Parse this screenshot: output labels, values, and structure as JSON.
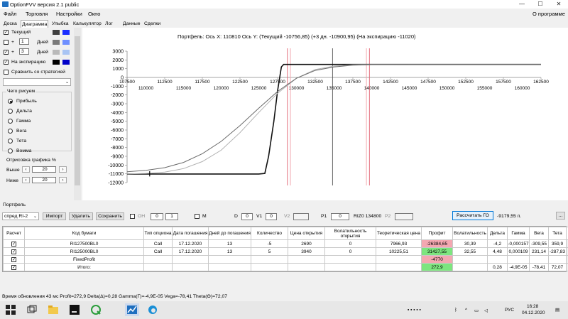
{
  "window": {
    "title": "OptionFVV версия 2.1 public",
    "buttons": [
      "—",
      "☐",
      "✕"
    ]
  },
  "menu": {
    "items": [
      "Файл",
      "Торговля",
      "Настройки",
      "Окно"
    ],
    "about": "О программе"
  },
  "tabs": [
    "Доска",
    "Диаграмма",
    "Улыбка",
    "Калькулятор",
    "Лог",
    "Данные",
    "Сделки"
  ],
  "left": {
    "current": {
      "label": "Текущий",
      "checked": true,
      "colors": [
        "#404040",
        "#1a2dff"
      ]
    },
    "plus1": {
      "sign": "+",
      "value": "1",
      "unit": "Дней",
      "checked": false,
      "colors": [
        "#7a7a7a",
        "#6f8fff"
      ]
    },
    "plus3": {
      "sign": "+",
      "value": "3",
      "unit": "Дней",
      "checked": true,
      "colors": [
        "#b9b9b9",
        "#a9c4f3"
      ]
    },
    "expiry": {
      "label": "На экспирацию",
      "checked": true,
      "colors": [
        "#000000",
        "#0000c8"
      ]
    },
    "compare": {
      "label": "Сравнить со стратегией",
      "checked": false
    },
    "what_label": "Чего рисуем",
    "radios": [
      "Прибыль",
      "Дельта",
      "Гамма",
      "Вега",
      "Тета",
      "Вомма"
    ],
    "selected_radio": 0,
    "draw_label": "Отрисовка графика %",
    "above_label": "Выше",
    "above_value": "20",
    "below_label": "Ниже",
    "below_value": "20"
  },
  "chart_title": "Портфель: Ось X: 110810 Ось Y: (Текущий -10756,85) (+3 дн. -10900,95) (На экспирацию -11020)",
  "chart_data": {
    "type": "line",
    "y_ticks": [
      3000,
      2000,
      1000,
      0,
      -1000,
      -2000,
      -3000,
      -4000,
      -5000,
      -6000,
      -7000,
      -8000,
      -9000,
      -10000,
      -11000,
      -12000
    ],
    "ylim": [
      -12000,
      3000
    ],
    "x_ticks_top": [
      107500,
      112500,
      117500,
      122500,
      127500,
      132500,
      137500,
      142500,
      147500,
      152500,
      157500,
      162500
    ],
    "x_ticks_bottom": [
      110000,
      115000,
      120000,
      125000,
      130000,
      135000,
      140000,
      145000,
      150000,
      155000,
      160000
    ],
    "xlim": [
      107500,
      162500
    ],
    "vlines": [
      {
        "x": 128800,
        "color": "#e06070"
      },
      {
        "x": 129200,
        "color": "#f0a0a8"
      },
      {
        "x": 134800,
        "color": "#555555"
      },
      {
        "x": 139300,
        "color": "#f0a0a8"
      },
      {
        "x": 139700,
        "color": "#e06070"
      }
    ],
    "series": [
      {
        "key": "expiry",
        "color": "#111111",
        "points": [
          [
            107500,
            -11020
          ],
          [
            110000,
            -11020
          ],
          [
            115000,
            -11020
          ],
          [
            120000,
            -11020
          ],
          [
            125000,
            -11020
          ],
          [
            125800,
            -10950
          ],
          [
            126300,
            -9000
          ],
          [
            127000,
            -5000
          ],
          [
            127500,
            -1500
          ],
          [
            128000,
            1200
          ],
          [
            128300,
            1480
          ],
          [
            130000,
            1480
          ],
          [
            135000,
            1480
          ],
          [
            140000,
            1480
          ],
          [
            145000,
            1480
          ],
          [
            150000,
            1480
          ],
          [
            155000,
            1480
          ],
          [
            160000,
            1480
          ],
          [
            162500,
            1480
          ]
        ]
      },
      {
        "key": "plus3",
        "color": "#b0b0b0",
        "points": [
          [
            107500,
            -11000
          ],
          [
            110000,
            -10950
          ],
          [
            112500,
            -10800
          ],
          [
            115000,
            -10400
          ],
          [
            117500,
            -9600
          ],
          [
            120000,
            -8300
          ],
          [
            122500,
            -6300
          ],
          [
            125000,
            -4000
          ],
          [
            127500,
            -1800
          ],
          [
            130000,
            -100
          ],
          [
            132500,
            900
          ],
          [
            135000,
            1300
          ],
          [
            137500,
            1450
          ],
          [
            140000,
            1480
          ],
          [
            145000,
            1480
          ],
          [
            150000,
            1480
          ],
          [
            162500,
            1480
          ]
        ]
      },
      {
        "key": "current",
        "color": "#6a6a6a",
        "points": [
          [
            107500,
            -10760
          ],
          [
            110000,
            -10600
          ],
          [
            112500,
            -10300
          ],
          [
            115000,
            -9700
          ],
          [
            117500,
            -8700
          ],
          [
            120000,
            -7300
          ],
          [
            122500,
            -5500
          ],
          [
            125000,
            -3500
          ],
          [
            127500,
            -1600
          ],
          [
            130000,
            -100
          ],
          [
            132500,
            800
          ],
          [
            135000,
            1200
          ],
          [
            137500,
            1400
          ],
          [
            140000,
            1460
          ],
          [
            145000,
            1480
          ],
          [
            150000,
            1480
          ],
          [
            162500,
            1480
          ]
        ]
      }
    ]
  },
  "portfolio_label": "Портфель",
  "controls": {
    "spread": "спред RI-2",
    "import": "Импорт",
    "delete": "Удалить",
    "save": "Сохранить",
    "oh_label": "OH",
    "oh_val1": "0",
    "oh_val2": "1",
    "m_label": "M",
    "d_label": "D",
    "d_val": "0",
    "v1_label": "V1",
    "v1_val": "0",
    "v2_label": "V2",
    "p1_label": "P1",
    "p1_val": "0",
    "ri_label": "RIZ0 134800",
    "p2_label": "P2",
    "calc_go": "Рассчитать ГО",
    "go_value": "-9179,55 п.",
    "dots": "..."
  },
  "table": {
    "headers": [
      "Расчет",
      "Код бумаги",
      "Тип опциона",
      "Дата погашения",
      "Дней до погашения",
      "Количество",
      "Цена открытия",
      "Волатильность открытия",
      "Теоретическая цена",
      "Профит",
      "Волатильность",
      "Дельта",
      "Гамма",
      "Вега",
      "Тета",
      "X"
    ],
    "rows": [
      {
        "checked": true,
        "cells": [
          "RI127500BL0",
          "Call",
          "17.12.2020",
          "13",
          "-5",
          "2690",
          "0",
          "7966,93",
          "-26384,65",
          "30,39",
          "-4,2",
          "-0,000157",
          "-309,55",
          "359,9",
          "X"
        ],
        "profit_class": "neg"
      },
      {
        "checked": true,
        "cells": [
          "RI125000BL0",
          "Call",
          "17.12.2020",
          "13",
          "5",
          "3940",
          "0",
          "10225,51",
          "31427,55",
          "32,55",
          "4,48",
          "0,000109",
          "231,14",
          "-287,83",
          "X"
        ],
        "profit_class": "pos"
      },
      {
        "checked": true,
        "cells": [
          "FixedProfit",
          "",
          "",
          "",
          "",
          "",
          "",
          "",
          "-4770",
          "",
          "",
          "",
          "",
          "",
          "X"
        ],
        "profit_class": "neg"
      },
      {
        "checked": true,
        "cells": [
          "Итого:",
          "",
          "",
          "",
          "",
          "",
          "",
          "",
          "272,9",
          "",
          "0,28",
          "-4,9E-05",
          "-78,41",
          "72,07",
          "X"
        ],
        "profit_class": "pos"
      }
    ]
  },
  "status": "Время обновления 43 мс  Profit=272,9 Delta(Δ)=0,28 Gamma(Γ)=-4,9E-05 Vega=-78,41 Theta(Θ)=72,07",
  "taskbar": {
    "lang": "РУС",
    "time": "16:28",
    "date": "04.12.2020"
  }
}
